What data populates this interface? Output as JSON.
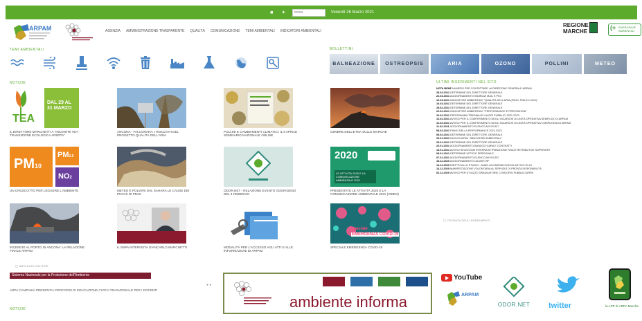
{
  "topbar": {
    "search_placeholder": "cerca",
    "date": "Venerdì 26 Marzo 2021"
  },
  "header": {
    "logo_text": "ARPAM",
    "nav": [
      "AGENZIA",
      "AMMINISTRAZIONE TRASPARENTE",
      "QUALITÀ",
      "COMUNICAZIONE",
      "TEMI AMBIENTALI",
      "INDICATORI AMBIENTALI"
    ],
    "regione": [
      "REGIONE",
      "MARCHE"
    ],
    "emergenze": [
      "EMERGENZE",
      "AMBIENTALI"
    ]
  },
  "temi": {
    "label": "TEMI AMBIENTALI",
    "icons": [
      "waves-icon",
      "wind-icon",
      "pipe-icon",
      "wifi-signal-icon",
      "trash-icon",
      "factory-icon",
      "flask-icon",
      "earth-icon",
      "soil-icon"
    ]
  },
  "bollettini": {
    "label": "BOLLETTINI",
    "items": [
      "BALNEAZIONE",
      "OSTREOPSIS",
      "ARIA",
      "OZONO",
      "POLLINI",
      "METEO"
    ]
  },
  "notizie": {
    "label": "NOTIZIE",
    "items": [
      {
        "caption": "IL DIRETTORE MARCHETTI A \"INCONTRI TEA - TRANSIZIONE ECOLOGICA APERTA\"",
        "thumb_title": "TEA",
        "thumb_badge": "DAL 29 AL 31 MARZO"
      },
      {
        "caption": "ANCONA - FALCONARA: I RISULTATI DEL PROGETTO QUALITÀ DELL'ARIA"
      },
      {
        "caption": "POLLINI E CAMBIAMENTI CLIMATICI: IL 9 APRILE SEMINARIO NAZIONALE ONLINE"
      },
      {
        "caption": "CENERE DELL'ETNA SULLE MARCHE"
      },
      {
        "caption": "UN CRUSCOTTO PER LEGGERE L'AMBIENTE",
        "pm10": "PM",
        "pm10_sub": "10",
        "pm25": "PM",
        "pm25_sub": "2.5",
        "no2": "NO",
        "no2_sub": "2"
      },
      {
        "caption": "METEO E POLVERI DAL SAHARA LE CAUSE DEI PICCHI DI PM10"
      },
      {
        "caption": "ODOR.NET - RELAZIONE EVENTO ODORIGENO DEL 4 FEBBRAIO"
      },
      {
        "caption": "PRESENTATE LE ATTIVITÀ 2020 E LA COMUNICAZIONE AMBIENTALE 2021 (VIDEO)",
        "thumb_title": "2020",
        "thumb_sub": "LE ATTIVITÀ 2020 E LA COMUNICAZIONE AMBIENTALE 2021"
      },
      {
        "caption": "INCENDIO AL PORTO DI ANCONA: LA RELAZIONE FINALE ARPAM"
      },
      {
        "caption": "IL SNPA INTERVISTA GIANCARLO MARCHETTI"
      },
      {
        "caption": "MODALITÀ PER L'ACCESSO AGLI ATTI E ALLE INFORMAZIONI DI ARPAM"
      },
      {
        "caption": "SPECIALE EMERGENZA COVID-19",
        "thumb_title": "speciale",
        "thumb_sub": "EMERGENZA COVID-19"
      }
    ],
    "archivio": "ARCHIVIO NOTIZIE"
  },
  "ultimi": {
    "label": "ULTIMI INSERIMENTI NEL SITO",
    "items": [
      {
        "date": "NOTA BENE",
        "text": "NUMERO PER CONTATTARE LA DIREZIONE GENERALE ARPAM"
      },
      {
        "date": "25.03.2021",
        "text": "DETERMINE DEL DIRETTORE GENERALE"
      },
      {
        "date": "22.03.2021",
        "text": "AGGIORNAMENTO INDIRIZZI MAIL E PEC"
      },
      {
        "date": "12.03.2021",
        "text": "INDICATORE AMBIENTALE \"QUALITÀ DELL'ARIA (PM10, PM2,5 e NO2)\""
      },
      {
        "date": "10.03.2021",
        "text": "DETERMINE DEL DIRETTORE GENERALE"
      },
      {
        "date": "25.02.2021",
        "text": "DETERMINE DEL DIRETTORE GENERALE"
      },
      {
        "date": "22.02.2021",
        "text": "INDICATORE AMBIENTALE \"PERFORMANCE E PRESTAZIONI\""
      },
      {
        "date": "16.02.2021",
        "text": "PROGRAMMA TRIENNALE LAVORI PUBBLICI 2021-2023"
      },
      {
        "date": "12.02.2021",
        "text": "AVVISO PER IL CONFERIMENTO DEGLI INCARICHI DI UNITÀ OPERATIVA SEMPLICE DI ARPAM"
      },
      {
        "date": "12.02.2021",
        "text": "AVVISO PER IL CONFERIMENTO DEGLI INCARICHI DI UNITÀ OPERATIVA COMPLESSA DI ARPAM"
      },
      {
        "date": "11.02.2021",
        "text": "AGGIORNAMENTO ELENCO AVVOCATI"
      },
      {
        "date": "08.02.2021",
        "text": "PIANO DELLA PERFORMANCE 2021-2023"
      },
      {
        "date": "05.02.2021",
        "text": "DETERMINE DEL DIRETTORE GENERALE"
      },
      {
        "date": "29.01.2021",
        "text": "NUOVO MENU \"INDICATORI AMBIENTALI\""
      },
      {
        "date": "25.01.2021",
        "text": "DETERMINE DEL DIRETTORE GENERALE"
      },
      {
        "date": "22.01.2021",
        "text": "AGGIORNAMENTO BANDI DI GARA E CONTRATTI"
      },
      {
        "date": "13.01.2021",
        "text": "AVVISO SELEZIONE INTERNA ATTRIBUZIONE FASCE RETRIBUTIVE SUPERIORI"
      },
      {
        "date": "08.01.2021",
        "text": "DETERMINE UFFICIO PERSONALE"
      },
      {
        "date": "07.01.2021",
        "text": "AGGIORNAMENTO ELENCO AVVOCATI"
      },
      {
        "date": "15.12.2020",
        "text": "AGGIORNAMENTO CATASTI RF"
      },
      {
        "date": "14.12.2020",
        "text": "DIRITTO ALLO STUDIO - ANNO ACCADEMICO/SCOLASTICO 20-21"
      },
      {
        "date": "14.12.2020",
        "text": "MANIFESTAZIONE VOLONTARIA AL SERVIZIO DI PRONTA DISPONIBILITÀ"
      },
      {
        "date": "02.12.2020",
        "text": "AVVISO PER UTILIZZO GRADUATORIE CONCORSI PUBBLICI ARPA"
      }
    ],
    "archivio": "CRONOLOGIA INSERIMENTI"
  },
  "footer": {
    "snpa_bar": "Sistema Nazionale per la Protezione dell'Ambiente",
    "snpa_text": "ARPA CAMPANIA PRESENTA I PERCORSI DI EDUCAZIONE CIVICA TRASVERSALE PER I DOCENTI",
    "ambiente_informa": "ambiente informa",
    "youtube": "YouTube",
    "arpam": "ARPAM",
    "odornet": "ODOR.NET",
    "twitter": "twitter",
    "app_label": "la APP di ARPA Marche",
    "notizie_label": "NOTIZIE"
  },
  "colors": {
    "green": "#5cab2c",
    "maroon": "#8c1a2e",
    "blue": "#4a86c5"
  }
}
